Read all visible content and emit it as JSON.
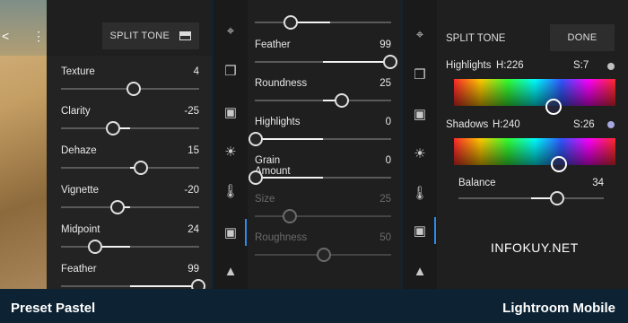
{
  "left_panel": {
    "header_button": "SPLIT TONE",
    "header_icon": "split-tone-icon",
    "sliders": [
      {
        "label": "Texture",
        "value": "4",
        "level": 0.52
      },
      {
        "label": "Clarity",
        "value": "-25",
        "level": 0.37
      },
      {
        "label": "Dehaze",
        "value": "15",
        "level": 0.57
      },
      {
        "label": "Vignette",
        "value": "-20",
        "level": 0.4
      },
      {
        "label": "Midpoint",
        "value": "24",
        "level": 0.24
      },
      {
        "label": "Feather",
        "value": "99",
        "level": 0.99
      }
    ]
  },
  "middle_panel": {
    "sliders": [
      {
        "label": "Feather",
        "value": "99",
        "level": 0.99,
        "disabled": false
      },
      {
        "label": "Roundness",
        "value": "25",
        "level": 0.63,
        "disabled": false
      },
      {
        "label": "Highlights",
        "value": "0",
        "level": 0.0,
        "disabled": false
      },
      {
        "label": "Grain Amount",
        "value": "0",
        "level": 0.0,
        "disabled": false
      },
      {
        "label": "Size",
        "value": "25",
        "level": 0.25,
        "disabled": true
      },
      {
        "label": "Roughness",
        "value": "50",
        "level": 0.5,
        "disabled": true
      }
    ]
  },
  "right_panel": {
    "title": "SPLIT TONE",
    "done_button": "DONE",
    "highlights": {
      "label": "Highlights",
      "hue_label": "H:226",
      "sat_label": "S:7",
      "dot_color": "#bfbfbf"
    },
    "shadows": {
      "label": "Shadows",
      "hue_label": "H:240",
      "sat_label": "S:26",
      "dot_color": "#a7a7e0"
    },
    "balance": {
      "label": "Balance",
      "value": "34",
      "level": 0.67
    },
    "watermark": "INFOKUY.NET"
  },
  "tool_rail": {
    "icons": [
      "crop-icon",
      "presets-icon",
      "auto-enhance-icon",
      "light-icon",
      "color-temperature-icon",
      "vignette-icon",
      "detail-icon"
    ],
    "selected": "vignette-icon"
  },
  "footer": {
    "left_text": "Preset Pastel",
    "right_text": "Lightroom Mobile"
  },
  "colors": {
    "accent": "#2d8ceb",
    "footer_bg": "#0d2333",
    "panel_bg": "#1f1f1f"
  }
}
